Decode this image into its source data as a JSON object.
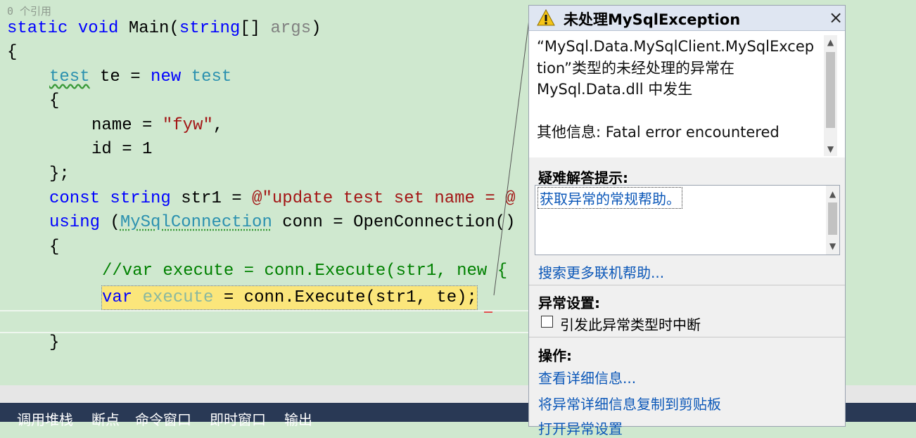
{
  "editor": {
    "ref_count": "0 个引用",
    "lines": {
      "l1": {
        "kw1": "static",
        "kw2": "void",
        "name": "Main(",
        "ty": "string",
        "arr": "[]",
        "arg": "args",
        "close": ")"
      },
      "l2": "{",
      "l3": {
        "ty": "test",
        "var": "te",
        "eq": "=",
        "kw": "new",
        "ty2": "test"
      },
      "l4": "{",
      "l5": {
        "prop": "name",
        "eq": "=",
        "str": "\"fyw\"",
        "comma": ","
      },
      "l6": "id = 1",
      "l7": "};",
      "l8": {
        "kw": "const",
        "ty": "string",
        "var": "str1",
        "eq": "=",
        "str": "@\"update test set name = @"
      },
      "l9": {
        "kw": "using",
        "paren": "(",
        "ty": "MySqlConnection",
        "rest": "conn = OpenConnection()"
      },
      "l10": "{",
      "l11": "//var execute = conn.Execute(str1, new {",
      "l12": {
        "kw": "var",
        "var": "execute",
        "rest": "= conn.Execute(str1, te);"
      },
      "l13": "}"
    }
  },
  "exception": {
    "title": "未处理MySqlException",
    "message_line1": "“MySql.Data.MySqlClient.MySqlExcep",
    "message_line2": "tion”类型的未经处理的异常在",
    "message_line3": "MySql.Data.dll 中发生",
    "extra_info": "其他信息: Fatal error encountered",
    "troubleshooting_title": "疑难解答提示:",
    "troubleshooting_link": "获取异常的常规帮助。",
    "search_online": "搜索更多联机帮助...",
    "settings_title": "异常设置:",
    "break_on_type": "引发此异常类型时中断",
    "actions_title": "操作:",
    "view_details": "查看详细信息...",
    "copy_details": "将异常详细信息复制到剪贴板",
    "open_settings": "打开异常设置"
  },
  "bottom_tabs": [
    "调用堆栈",
    "断点",
    "命令窗口",
    "即时窗口",
    "输出"
  ],
  "colors": {
    "editor_bg": "#cfe8cf",
    "keyword": "#0000ff",
    "type": "#2b91af",
    "string": "#a31515",
    "comment": "#008000",
    "current_line": "#fbe67b",
    "link": "#0b57b8",
    "tabbar": "#293955"
  }
}
